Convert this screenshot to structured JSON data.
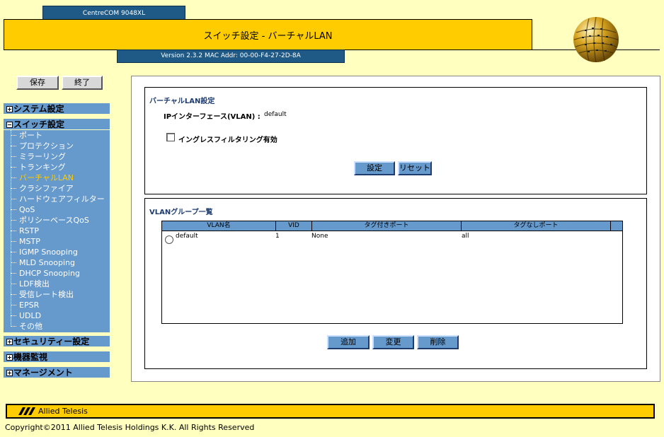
{
  "header": {
    "model": "CentreCOM 9048XL",
    "title": "スイッチ設定 - バーチャルLAN",
    "version": "Version 2.3.2 MAC Addr: 00-00-F4-27-2D-8A"
  },
  "sidebar": {
    "save_label": "保存",
    "exit_label": "終了",
    "groups": {
      "system": "システム設定",
      "switch": "スイッチ設定",
      "security": "セキュリティー設定",
      "monitor": "機器監視",
      "management": "マネージメント"
    },
    "switch_items": [
      "ポート",
      "プロテクション",
      "ミラーリング",
      "トランキング",
      "バーチャルLAN",
      "クラシファイア",
      "ハードウェアフィルター",
      "QoS",
      "ポリシーベースQoS",
      "RSTP",
      "MSTP",
      "IGMP Snooping",
      "MLD Snooping",
      "DHCP Snooping",
      "LDF検出",
      "受信レート検出",
      "EPSR",
      "UDLD",
      "その他"
    ],
    "active_item": "バーチャルLAN"
  },
  "vlan_settings": {
    "title": "バーチャルLAN設定",
    "ip_interface_label": "IPインターフェース(VLAN) :",
    "ip_interface_value": "default",
    "ingress_filter_label": "イングレスフィルタリング有効",
    "ingress_filter_checked": false,
    "set_label": "設定",
    "reset_label": "リセット"
  },
  "vlan_groups": {
    "title": "VLANグループ一覧",
    "columns": [
      "VLAN名",
      "VID",
      "タグ付きポート",
      "タグなしポート"
    ],
    "rows": [
      {
        "name": "default",
        "vid": "1",
        "tagged": "None",
        "untagged": "all"
      }
    ],
    "add_label": "追加",
    "modify_label": "変更",
    "delete_label": "削除"
  },
  "footer": {
    "logo": "Allied Telesis",
    "copyright": "Copyright©2011 Allied Telesis Holdings K.K. All Rights Reserved"
  },
  "colors": {
    "background": "#ffffc0",
    "accent_yellow": "#ffcc00",
    "nav_blue": "#6699cc",
    "header_blue": "#1f5a87"
  }
}
